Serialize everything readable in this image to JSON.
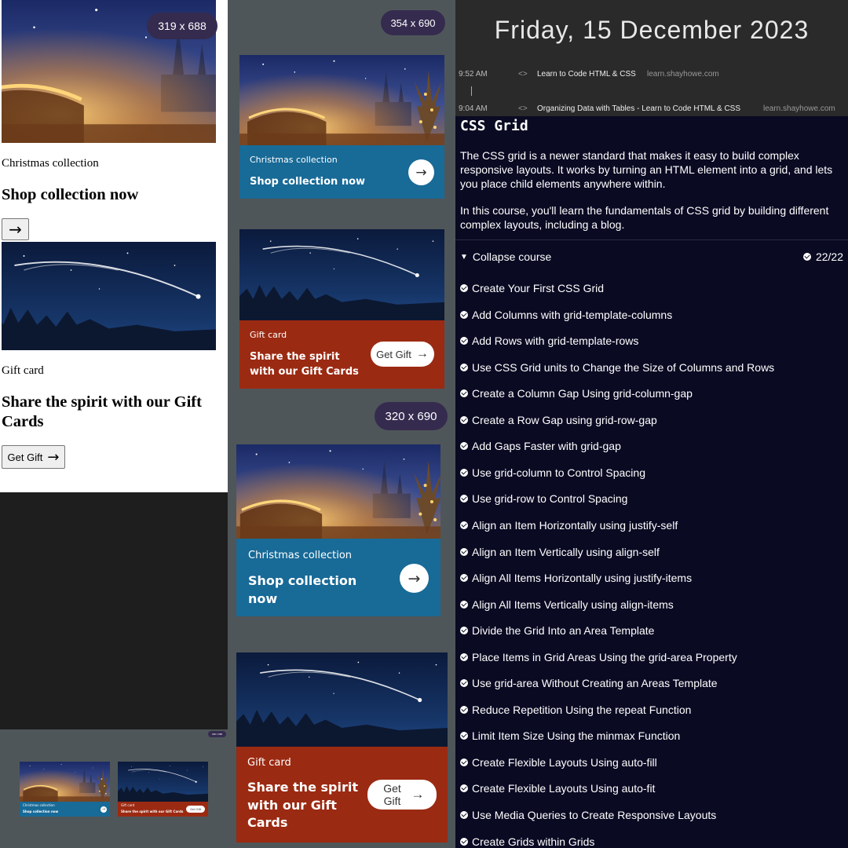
{
  "history": {
    "date": "Friday, 15 December 2023",
    "entries": [
      {
        "time": "9:52 AM",
        "icon": "<>",
        "title": "Learn to Code HTML & CSS",
        "host": "learn.shayhowe.com"
      },
      {
        "time": "9:04 AM",
        "icon": "<>",
        "title": "Organizing Data with Tables - Learn to Code HTML & CSS",
        "host": "learn.shayhowe.com"
      }
    ]
  },
  "preview": {
    "size_badge_1": "319 x 688",
    "size_badge_2": "354 x 690",
    "size_badge_3": "320 x 690",
    "christmas_label": "Christmas collection",
    "christmas_title": "Shop collection now",
    "gift_label": "Gift card",
    "gift_title": "Share the spirit with our Gift Cards",
    "gift_button": "Get Gift",
    "arrow": "→"
  },
  "course": {
    "title": "CSS Grid",
    "description_1": "The CSS grid is a newer standard that makes it easy to build complex responsive layouts. It works by turning an HTML element into a grid, and lets you place child elements anywhere within.",
    "description_2": "In this course, you'll learn the fundamentals of CSS grid by building different complex layouts, including a blog.",
    "collapse_label": "Collapse course",
    "collapse_icon": "▼",
    "progress": "22/22",
    "lessons": [
      "Create Your First CSS Grid",
      "Add Columns with grid-template-columns",
      "Add Rows with grid-template-rows",
      "Use CSS Grid units to Change the Size of Columns and Rows",
      "Create a Column Gap Using grid-column-gap",
      "Create a Row Gap using grid-row-gap",
      "Add Gaps Faster with grid-gap",
      "Use grid-column to Control Spacing",
      "Use grid-row to Control Spacing",
      "Align an Item Horizontally using justify-self",
      "Align an Item Vertically using align-self",
      "Align All Items Horizontally using justify-items",
      "Align All Items Vertically using align-items",
      "Divide the Grid Into an Area Template",
      "Place Items in Grid Areas Using the grid-area Property",
      "Use grid-area Without Creating an Areas Template",
      "Reduce Repetition Using the repeat Function",
      "Limit Item Size Using the minmax Function",
      "Create Flexible Layouts Using auto-fill",
      "Create Flexible Layouts Using auto-fit",
      "Use Media Queries to Create Responsive Layouts",
      "Create Grids within Grids"
    ]
  },
  "colors": {
    "card_blue": "#186a97",
    "card_rust": "#9b2a12",
    "badge": "#352b4f",
    "course_bg": "#0a0a23"
  }
}
